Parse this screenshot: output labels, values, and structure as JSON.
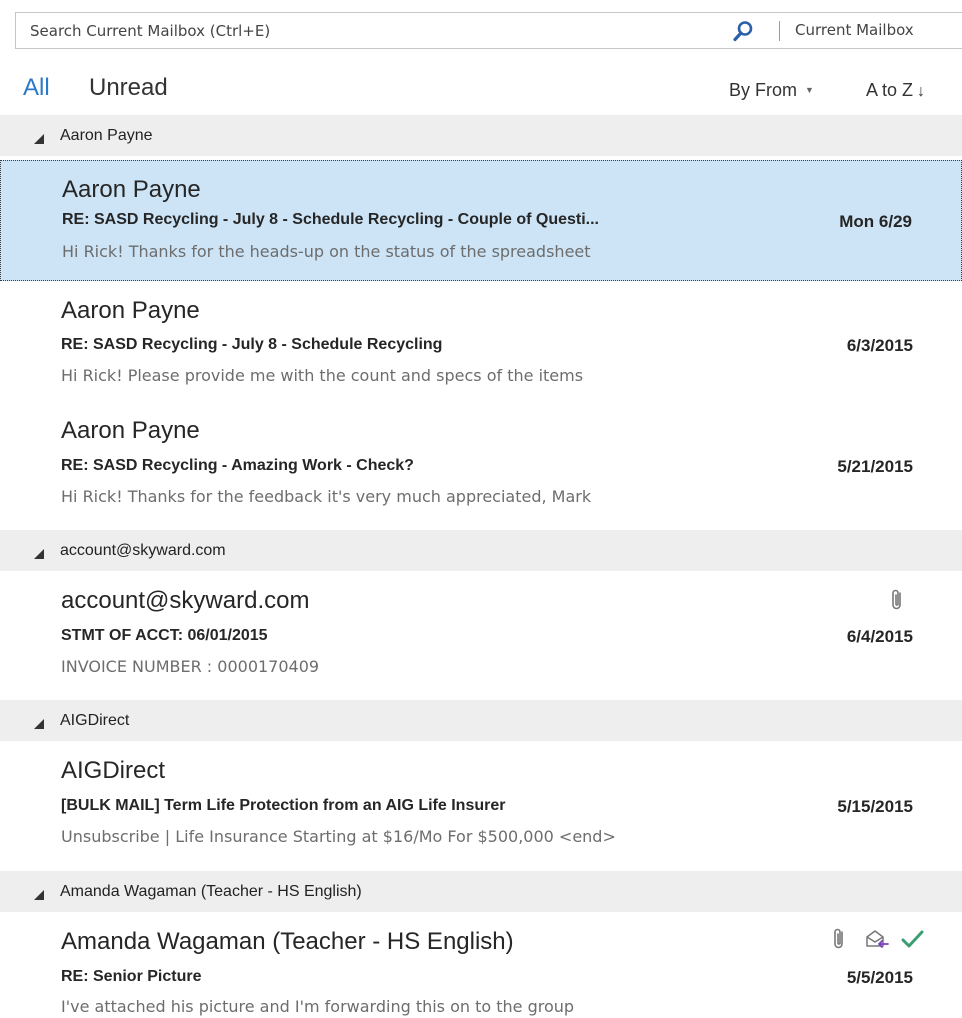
{
  "search": {
    "placeholder": "Search Current Mailbox (Ctrl+E)",
    "scope": "Current Mailbox"
  },
  "filters": {
    "all": "All",
    "unread": "Unread",
    "sort_by": "By From",
    "sort_order": "A to Z"
  },
  "icons": {
    "search": "search-icon",
    "attachment": "paperclip-icon",
    "forwarded": "envelope-forward-icon",
    "complete": "checkmark-icon",
    "collapse": "collapse-triangle-icon"
  },
  "colors": {
    "accent": "#2b79c9",
    "selected": "#cce4f6",
    "group_bg": "#eeeeee",
    "check": "#3a9e73",
    "forward": "#7c3fbf"
  },
  "groups": [
    {
      "label": "Aaron Payne",
      "items": [
        {
          "from": "Aaron Payne",
          "subject": "RE: SASD Recycling - July 8 - Schedule Recycling - Couple of Questi...",
          "preview": "Hi Rick!  Thanks for the heads-up on the status of the spreadsheet",
          "date": "Mon 6/29",
          "selected": true
        },
        {
          "from": "Aaron Payne",
          "subject": "RE: SASD Recycling - July 8 - Schedule Recycling",
          "preview": "Hi Rick!  Please provide me with the count and specs of the items",
          "date": "6/3/2015"
        },
        {
          "from": "Aaron Payne",
          "subject": "RE: SASD Recycling - Amazing Work - Check?",
          "preview": "Hi Rick!  Thanks for the feedback it's very much appreciated, Mark",
          "date": "5/21/2015"
        }
      ]
    },
    {
      "label": "account@skyward.com",
      "items": [
        {
          "from": "account@skyward.com",
          "subject": "STMT OF ACCT: 06/01/2015",
          "preview": "INVOICE NUMBER     : 0000170409",
          "date": "6/4/2015",
          "attachment": true
        }
      ]
    },
    {
      "label": "AIGDirect",
      "items": [
        {
          "from": "AIGDirect",
          "subject": "[BULK MAIL] Term Life Protection from an AIG Life Insurer",
          "preview": "Unsubscribe | Life Insurance Starting at $16/Mo For $500,000 <end>",
          "date": "5/15/2015"
        }
      ]
    },
    {
      "label": "Amanda Wagaman (Teacher - HS English)",
      "items": [
        {
          "from": "Amanda Wagaman (Teacher - HS English)",
          "subject": "RE: Senior Picture",
          "preview": "I've attached his picture and I'm forwarding this on to the group",
          "date": "5/5/2015",
          "attachment": true,
          "forwarded": true,
          "complete": true
        }
      ]
    }
  ]
}
